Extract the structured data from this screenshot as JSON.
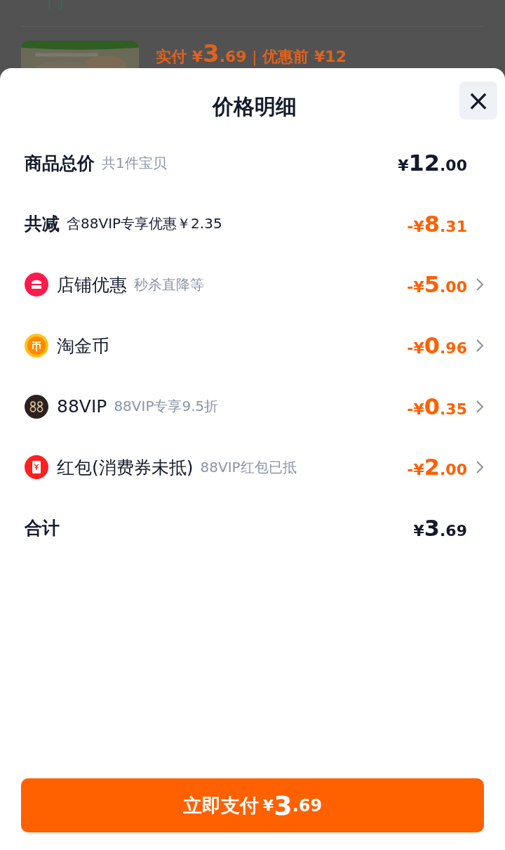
{
  "backdrop": {
    "price_line": {
      "label": "实付",
      "currency": "¥",
      "integer": "3",
      "decimal": ".69",
      "separator": "|",
      "original": "优惠前 ¥12"
    }
  },
  "sheet": {
    "title": "价格明细",
    "close": "×"
  },
  "rows": [
    {
      "kind": "summary",
      "label": "商品总价",
      "note": "共1件宝贝",
      "amount": {
        "prefix": "¥",
        "integer": "12",
        "decimal": ".00"
      },
      "deduction": false
    },
    {
      "kind": "summary",
      "label": "共减",
      "note": "含88VIP专享优惠￥2.35",
      "amount": {
        "prefix": "-¥",
        "integer": "8",
        "decimal": ".31"
      },
      "deduction": true
    },
    {
      "kind": "shop",
      "label": "店铺优惠",
      "note": "秒杀直降等",
      "amount": {
        "prefix": "-¥",
        "integer": "5",
        "decimal": ".00"
      },
      "deduction": true
    },
    {
      "kind": "coin",
      "label": "淘金币",
      "amount": {
        "prefix": "-¥",
        "integer": "0",
        "decimal": ".96"
      },
      "deduction": true
    },
    {
      "kind": "vip",
      "label": "88VIP",
      "note": "88VIP专享9.5折",
      "amount": {
        "prefix": "-¥",
        "integer": "0",
        "decimal": ".35"
      },
      "deduction": true
    },
    {
      "kind": "envelope",
      "label": "红包(消费券未抵)",
      "note": "88VIP红包已抵",
      "amount": {
        "prefix": "-¥",
        "integer": "2",
        "decimal": ".00"
      },
      "deduction": true
    },
    {
      "kind": "summary",
      "label": "合计",
      "amount": {
        "prefix": "¥",
        "integer": "3",
        "decimal": ".69"
      },
      "deduction": false
    }
  ],
  "pay_button": {
    "label": "立即支付",
    "prefix": "¥",
    "integer": "3",
    "decimal": ".69"
  }
}
